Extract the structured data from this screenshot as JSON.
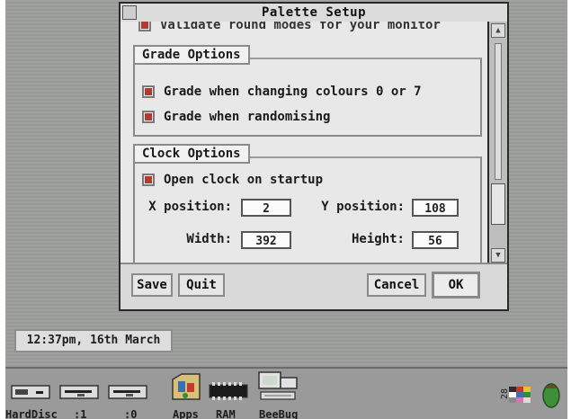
{
  "window": {
    "title": "Palette Setup",
    "cut_option": "Validate round modes for your monitor"
  },
  "grade_options": {
    "heading": "Grade Options",
    "items": [
      {
        "label": "Grade when changing colours 0 or 7",
        "checked": true
      },
      {
        "label": "Grade when randomising",
        "checked": true
      }
    ]
  },
  "clock_options": {
    "heading": "Clock Options",
    "open_on_startup": {
      "label": "Open clock on startup",
      "checked": true
    },
    "x_position": {
      "label": "X position:",
      "value": "2"
    },
    "y_position": {
      "label": "Y position:",
      "value": "108"
    },
    "width": {
      "label": "Width:",
      "value": "392"
    },
    "height": {
      "label": "Height:",
      "value": "56"
    }
  },
  "buttons": {
    "save": "Save",
    "quit": "Quit",
    "cancel": "Cancel",
    "ok": "OK"
  },
  "clock": {
    "text": "12:37pm, 16th March"
  },
  "iconbar": {
    "items": [
      {
        "label": "HardDisc",
        "icon": "hard-disc-icon"
      },
      {
        "label": ":1",
        "icon": "floppy-drive-icon"
      },
      {
        "label": ":0",
        "icon": "floppy-drive-icon"
      },
      {
        "label": "Apps",
        "icon": "apps-folder-icon"
      },
      {
        "label": "RAM",
        "icon": "ram-disc-icon"
      },
      {
        "label": "BeeBug",
        "icon": "beebug-icon"
      }
    ],
    "colors": {
      "accent_red": "#b33a2e",
      "acorn_green": "#3f8f3a"
    }
  }
}
